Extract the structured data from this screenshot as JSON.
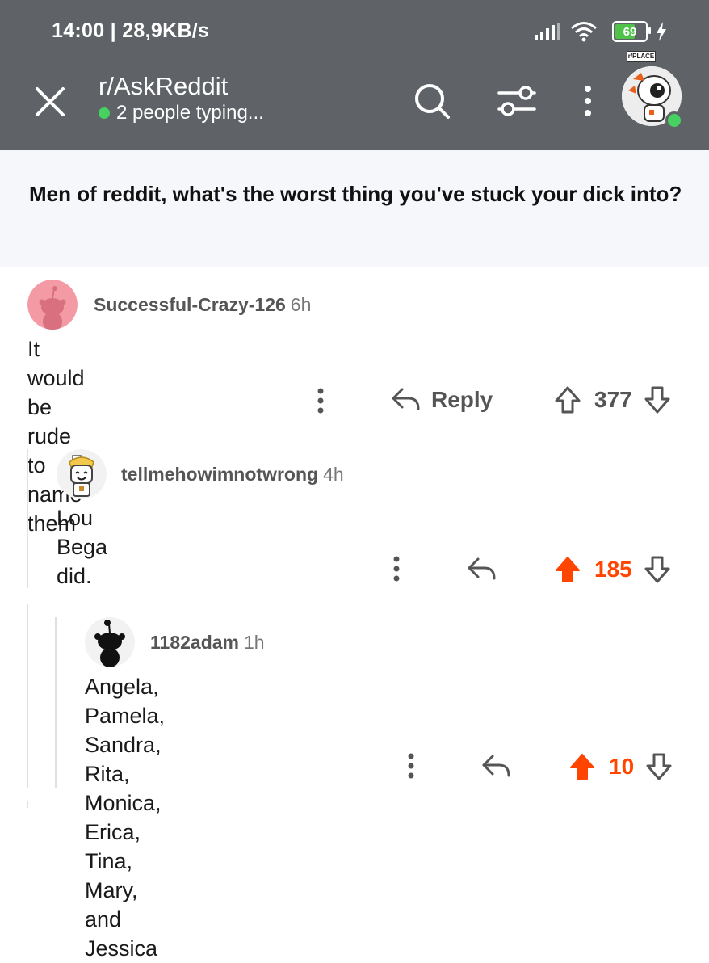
{
  "status_bar": {
    "time_speed": "14:00 | 28,9KB/s",
    "battery": "69"
  },
  "header": {
    "subreddit": "r/AskReddit",
    "typing": "2 people typing...",
    "place_tag": "r/PLACE",
    "icons": [
      "close-icon",
      "search-icon",
      "filter-icon",
      "more-icon"
    ]
  },
  "post": {
    "title": "Men of reddit, what's the worst thing you've stuck your dick into?"
  },
  "comments": [
    {
      "author": "Successful-Crazy-126",
      "age": "6h",
      "body": "It would be rude to name them",
      "reply_label": "Reply",
      "votes": "377",
      "upvoted": false,
      "avatar_color": "#f49aa5"
    },
    {
      "author": "tellmehowimnotwrong",
      "age": "4h",
      "body": "Lou Bega did.",
      "reply_label": "",
      "votes": "185",
      "upvoted": true
    },
    {
      "author": "1182adam",
      "age": "1h",
      "body_line1": "Angela, Pamela, Sandra, Rita, Monica, Erica, Tina,",
      "body_line2": "Mary, and  Jessica",
      "reply_label": "",
      "votes": "10",
      "upvoted": true
    }
  ],
  "colors": {
    "header_bg": "#5f6367",
    "online": "#46d160",
    "upvote": "#ff4500"
  }
}
